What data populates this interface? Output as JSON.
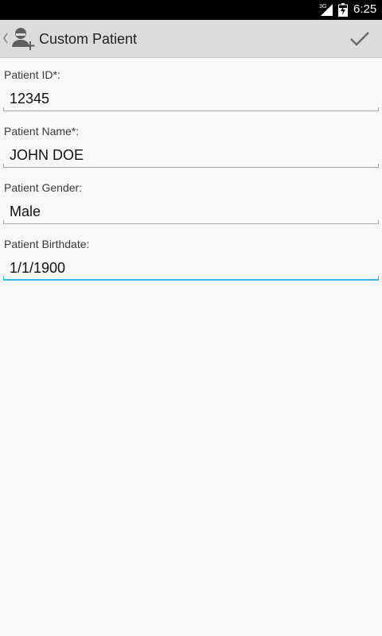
{
  "status_bar": {
    "network": "3G",
    "time": "6:25",
    "icons": [
      "signal-icon",
      "battery-icon"
    ]
  },
  "action_bar": {
    "title": "Custom Patient",
    "icons": [
      "back-chevron-icon",
      "add-person-icon",
      "checkmark-icon"
    ]
  },
  "form": {
    "fields": [
      {
        "label": "Patient ID*:",
        "value": "12345"
      },
      {
        "label": "Patient Name*:",
        "value": "JOHN DOE"
      },
      {
        "label": "Patient Gender:",
        "value": "Male"
      },
      {
        "label": "Patient Birthdate:",
        "value": "1/1/1900"
      }
    ]
  },
  "colors": {
    "focus_accent": "#33b5e5",
    "action_bar_bg": "#dcdcdc",
    "page_bg": "#f8f8f8"
  }
}
